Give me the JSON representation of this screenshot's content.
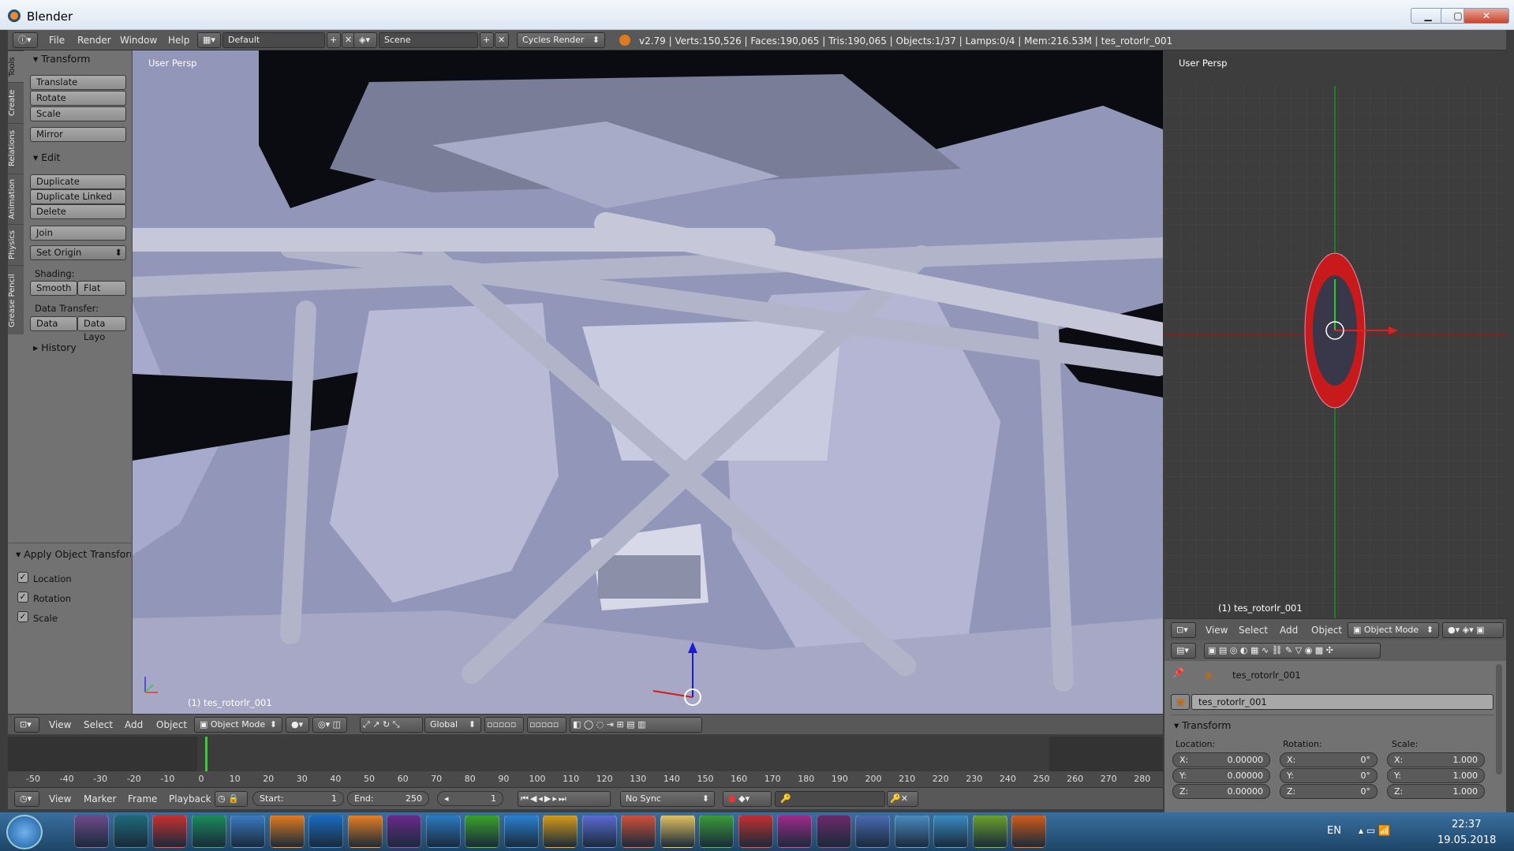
{
  "window": {
    "title": "Blender",
    "minimize": "▁",
    "maximize": "▢",
    "close": "✕"
  },
  "info_bar": {
    "menus": [
      "File",
      "Render",
      "Window",
      "Help"
    ],
    "layout": "Default",
    "scene": "Scene",
    "engine": "Cycles Render",
    "stats": "v2.79 | Verts:150,526 | Faces:190,065 | Tris:190,065 | Objects:1/37 | Lamps:0/4 | Mem:216.53M | tes_rotorlr_001"
  },
  "tool_shelf": {
    "tabs": [
      "Tools",
      "Create",
      "Relations",
      "Animation",
      "Physics",
      "Grease Pencil"
    ],
    "transform": {
      "header": "Transform",
      "buttons": [
        "Translate",
        "Rotate",
        "Scale",
        "Mirror"
      ]
    },
    "edit": {
      "header": "Edit",
      "buttons": [
        "Duplicate",
        "Duplicate Linked",
        "Delete",
        "Join"
      ]
    },
    "set_origin": "Set Origin",
    "shading_label": "Shading:",
    "shading_buttons": [
      "Smooth",
      "Flat"
    ],
    "data_transfer_label": "Data Transfer:",
    "data_transfer_buttons": [
      "Data",
      "Data Layo"
    ],
    "history": "History",
    "operator": {
      "header": "Apply Object Transform",
      "options": [
        "Location",
        "Rotation",
        "Scale"
      ]
    }
  },
  "viewport_main": {
    "view_label": "User Persp",
    "object_label": "(1) tes_rotorlr_001",
    "header_menus": [
      "View",
      "Select",
      "Add",
      "Object"
    ],
    "mode": "Object Mode",
    "orientation": "Global"
  },
  "viewport_top": {
    "view_label": "User Persp",
    "object_label": "(1) tes_rotorlr_001"
  },
  "timeline": {
    "ticks": [
      "-50",
      "-40",
      "-30",
      "-20",
      "-10",
      "0",
      "10",
      "20",
      "30",
      "40",
      "50",
      "60",
      "70",
      "80",
      "90",
      "100",
      "110",
      "120",
      "130",
      "140",
      "150",
      "160",
      "170",
      "180",
      "190",
      "200",
      "210",
      "220",
      "230",
      "240",
      "250",
      "260",
      "270",
      "280"
    ],
    "menus": [
      "View",
      "Marker",
      "Frame",
      "Playback"
    ],
    "start_label": "Start:",
    "start": "1",
    "end_label": "End:",
    "end": "250",
    "current": "1",
    "sync": "No Sync"
  },
  "properties": {
    "header_menus": [
      "View",
      "Select",
      "Add",
      "Object"
    ],
    "mode": "Object Mode",
    "breadcrumb": "tes_rotorlr_001",
    "object_name": "tes_rotorlr_001",
    "panel": "Transform",
    "location_label": "Location:",
    "rotation_label": "Rotation:",
    "scale_label": "Scale:",
    "location": [
      {
        "axis": "X:",
        "value": "0.00000"
      },
      {
        "axis": "Y:",
        "value": "0.00000"
      },
      {
        "axis": "Z:",
        "value": "0.00000"
      }
    ],
    "rotation": [
      {
        "axis": "X:",
        "value": "0°"
      },
      {
        "axis": "Y:",
        "value": "0°"
      },
      {
        "axis": "Z:",
        "value": "0°"
      }
    ],
    "scale": [
      {
        "axis": "X:",
        "value": "1.000"
      },
      {
        "axis": "Y:",
        "value": "1.000"
      },
      {
        "axis": "Z:",
        "value": "1.000"
      }
    ]
  },
  "taskbar": {
    "lang": "EN",
    "time": "22:37",
    "date": "19.05.2018"
  }
}
